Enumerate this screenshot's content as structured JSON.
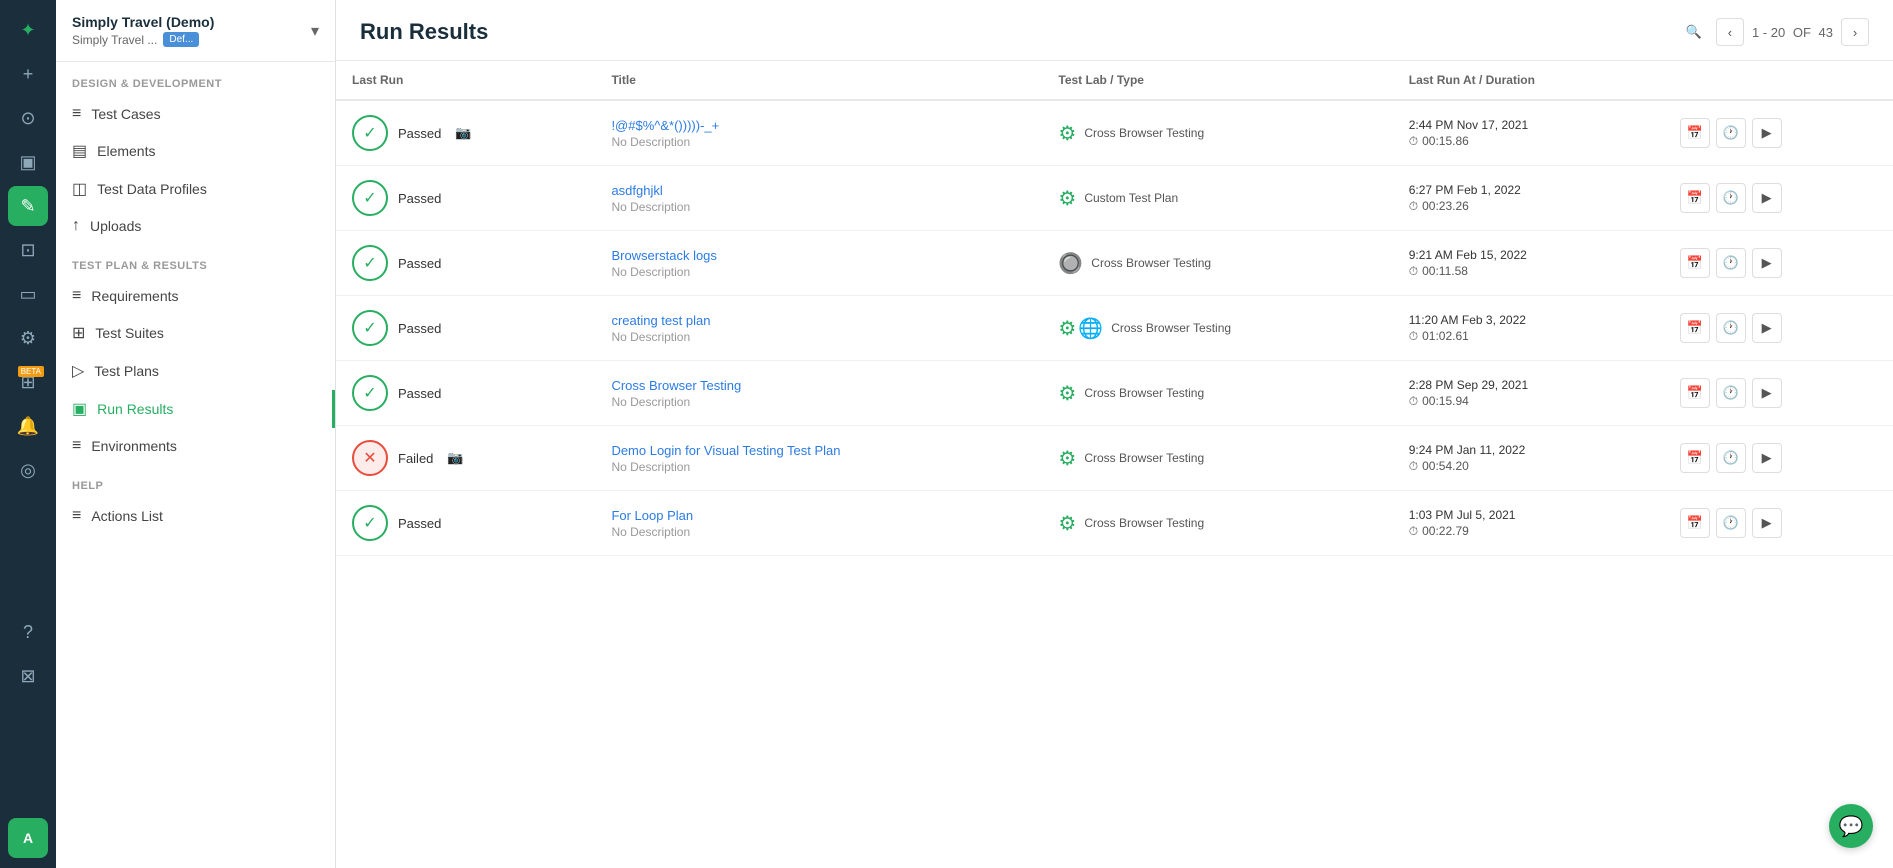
{
  "app": {
    "name": "Simply Travel (Demo)",
    "sub": "Simply Travel ...",
    "badge": "Def..."
  },
  "iconBar": {
    "items": [
      {
        "name": "logo-icon",
        "symbol": "✦",
        "active": false
      },
      {
        "name": "plus-icon",
        "symbol": "+",
        "active": false
      },
      {
        "name": "dashboard-icon",
        "symbol": "⊙",
        "active": false
      },
      {
        "name": "monitor-icon",
        "symbol": "▣",
        "active": false
      },
      {
        "name": "edit-icon",
        "symbol": "✎",
        "active": true
      },
      {
        "name": "briefcase-icon",
        "symbol": "⊡",
        "active": false
      },
      {
        "name": "desktop-icon",
        "symbol": "▭",
        "active": false
      },
      {
        "name": "settings-icon",
        "symbol": "⚙",
        "active": false
      },
      {
        "name": "puzzle-icon",
        "symbol": "⊞",
        "active": false
      },
      {
        "name": "bell-icon",
        "symbol": "🔔",
        "active": false
      },
      {
        "name": "chart-icon",
        "symbol": "◎",
        "active": false
      },
      {
        "name": "help-icon",
        "symbol": "?",
        "active": false
      },
      {
        "name": "gift-icon",
        "symbol": "⊠",
        "active": false
      },
      {
        "name": "avatar-icon",
        "symbol": "A",
        "active": false
      }
    ]
  },
  "sidebar": {
    "section1": "DESIGN & DEVELOPMENT",
    "section2": "TEST PLAN & RESULTS",
    "section3": "HELP",
    "navItems": [
      {
        "id": "test-cases",
        "label": "Test Cases",
        "icon": "≡",
        "section": 1,
        "active": false
      },
      {
        "id": "elements",
        "label": "Elements",
        "icon": "▤",
        "section": 1,
        "active": false
      },
      {
        "id": "test-data-profiles",
        "label": "Test Data Profiles",
        "icon": "◫",
        "section": 1,
        "active": false
      },
      {
        "id": "uploads",
        "label": "Uploads",
        "icon": "↑",
        "section": 1,
        "active": false
      },
      {
        "id": "requirements",
        "label": "Requirements",
        "icon": "≡",
        "section": 2,
        "active": false
      },
      {
        "id": "test-suites",
        "label": "Test Suites",
        "icon": "⊞",
        "section": 2,
        "active": false
      },
      {
        "id": "test-plans",
        "label": "Test Plans",
        "icon": "▷",
        "section": 2,
        "active": false
      },
      {
        "id": "run-results",
        "label": "Run Results",
        "icon": "▣",
        "section": 2,
        "active": true
      },
      {
        "id": "environments",
        "label": "Environments",
        "icon": "≡",
        "section": 2,
        "active": false
      },
      {
        "id": "actions-list",
        "label": "Actions List",
        "icon": "≡",
        "section": 3,
        "active": false
      }
    ]
  },
  "main": {
    "title": "Run Results",
    "pagination": {
      "range": "1 - 20",
      "of": "OF",
      "total": "43"
    },
    "columns": [
      "Last Run",
      "Title",
      "Test Lab / Type",
      "Last Run At / Duration"
    ],
    "rows": [
      {
        "status": "passed",
        "statusLabel": "Passed",
        "hasCamera": true,
        "title": "!@#$%^&*()))))-_+",
        "desc": "No Description",
        "labIcons": [
          "gear"
        ],
        "labName": "Cross Browser Testing",
        "time": "2:44 PM Nov 17, 2021",
        "duration": "00:15.86"
      },
      {
        "status": "passed",
        "statusLabel": "Passed",
        "hasCamera": false,
        "title": "asdfghjkl",
        "desc": "No Description",
        "labIcons": [
          "gear"
        ],
        "labName": "Custom Test Plan",
        "time": "6:27 PM Feb 1, 2022",
        "duration": "00:23.26"
      },
      {
        "status": "passed",
        "statusLabel": "Passed",
        "hasCamera": false,
        "title": "Browserstack logs",
        "desc": "No Description",
        "labIcons": [
          "bs"
        ],
        "labName": "Cross Browser Testing",
        "time": "9:21 AM Feb 15, 2022",
        "duration": "00:11.58"
      },
      {
        "status": "passed",
        "statusLabel": "Passed",
        "hasCamera": false,
        "title": "creating test plan",
        "desc": "No Description",
        "labIcons": [
          "gear",
          "chrome"
        ],
        "labName": "Cross Browser Testing",
        "time": "11:20 AM Feb 3, 2022",
        "duration": "01:02.61"
      },
      {
        "status": "passed",
        "statusLabel": "Passed",
        "hasCamera": false,
        "title": "Cross Browser Testing",
        "desc": "No Description",
        "labIcons": [
          "gear"
        ],
        "labName": "Cross Browser Testing",
        "time": "2:28 PM Sep 29, 2021",
        "duration": "00:15.94"
      },
      {
        "status": "failed",
        "statusLabel": "Failed",
        "hasCamera": true,
        "title": "Demo Login for Visual Testing Test Plan",
        "desc": "No Description",
        "labIcons": [
          "gear"
        ],
        "labName": "Cross Browser Testing",
        "time": "9:24 PM Jan 11, 2022",
        "duration": "00:54.20"
      },
      {
        "status": "passed",
        "statusLabel": "Passed",
        "hasCamera": false,
        "title": "For Loop Plan",
        "desc": "No Description",
        "labIcons": [
          "gear"
        ],
        "labName": "Cross Browser Testing",
        "time": "1:03 PM Jul 5, 2021",
        "duration": "00:22.79"
      }
    ]
  }
}
